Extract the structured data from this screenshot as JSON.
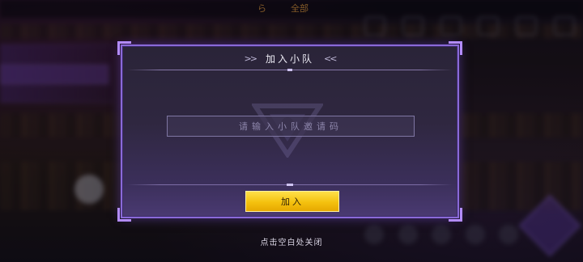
{
  "hud": {
    "left_text": "ら",
    "right_text": "全部"
  },
  "dialog": {
    "title": "加入小队",
    "title_deco_left": ">>",
    "title_deco_right": "<<",
    "input": {
      "value": "",
      "placeholder": "请输入小队邀请码"
    },
    "join_button_label": "加入"
  },
  "close_hint": "点击空白处关闭",
  "colors": {
    "dialog_border": "#8a6ad8",
    "button_gold": "#f4c10f",
    "input_border": "#7f76a3"
  },
  "icons": [
    "team-emblem-icon",
    "joystick-icon",
    "skill-icon"
  ]
}
